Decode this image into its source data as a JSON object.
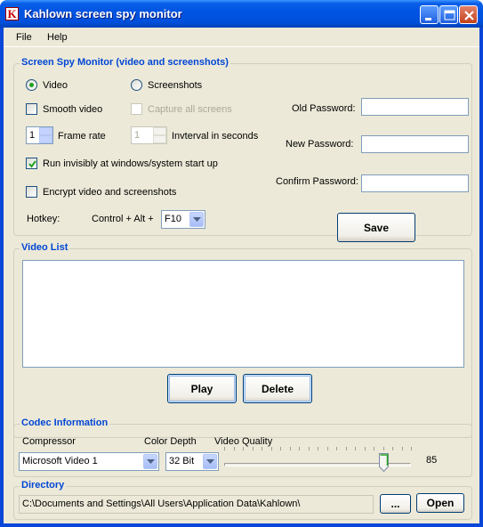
{
  "window": {
    "title": "Kahlown screen spy monitor",
    "icon_letter": "K"
  },
  "menu": {
    "items": [
      "File",
      "Help"
    ]
  },
  "monitor": {
    "legend": "Screen Spy Monitor (video and screenshots)",
    "video_radio": "Video",
    "screenshots_radio": "Screenshots",
    "smooth_video": "Smooth video",
    "capture_all": "Capture all screens",
    "frame_rate_value": "1",
    "frame_rate_label": "Frame rate",
    "interval_value": "1",
    "interval_label": "Invterval in seconds",
    "run_invisibly": "Run invisibly at windows/system start up",
    "encrypt": "Encrypt video and screenshots",
    "hotkey_label": "Hotkey:",
    "hotkey_combo": "Control + Alt +",
    "hotkey_key": "F10",
    "old_password": "Old Password:",
    "new_password": "New Password:",
    "confirm_password": "Confirm Password:",
    "save": "Save"
  },
  "video_list": {
    "legend": "Video List",
    "play": "Play",
    "delete": "Delete"
  },
  "codec": {
    "legend": "Codec Information",
    "compressor_label": "Compressor",
    "compressor_value": "Microsoft Video 1",
    "color_depth_label": "Color Depth",
    "color_depth_value": "32 Bit",
    "video_quality_label": "Video Quality",
    "video_quality_value": "85",
    "video_quality_level": 85
  },
  "directory": {
    "legend": "Directory",
    "path": "C:\\Documents and Settings\\All Users\\Application Data\\Kahlown\\",
    "browse": "...",
    "open": "Open"
  },
  "colors": {
    "titlebar": "#0054e3",
    "legend_text": "#0046d5",
    "face": "#ece9d8",
    "check_mark": "#21a121"
  }
}
